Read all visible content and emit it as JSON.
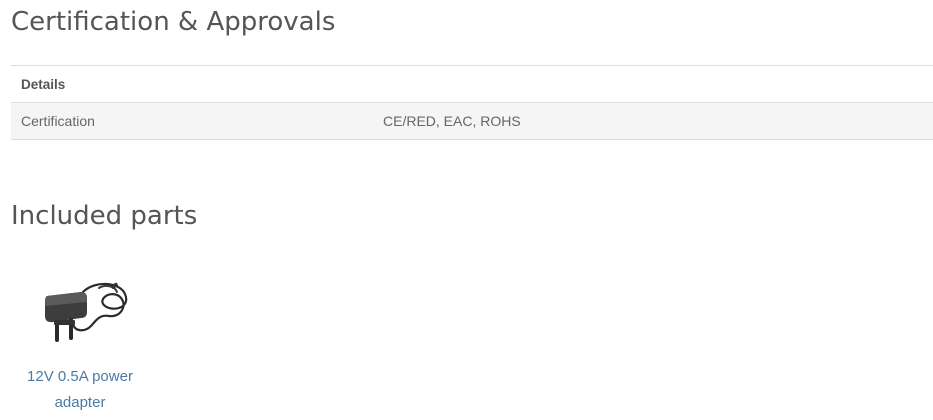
{
  "certification": {
    "title": "Certification & Approvals",
    "table": {
      "header": "Details",
      "rows": [
        {
          "label": "Certification",
          "value": "CE/RED, EAC, ROHS"
        }
      ]
    }
  },
  "included_parts": {
    "title": "Included parts",
    "items": [
      {
        "label": "12V 0.5A power adapter",
        "icon": "power-adapter-image"
      }
    ]
  },
  "colors": {
    "link": "#4a7aa7",
    "text": "#555555",
    "row_background": "#f5f5f5",
    "border": "#dddddd"
  }
}
